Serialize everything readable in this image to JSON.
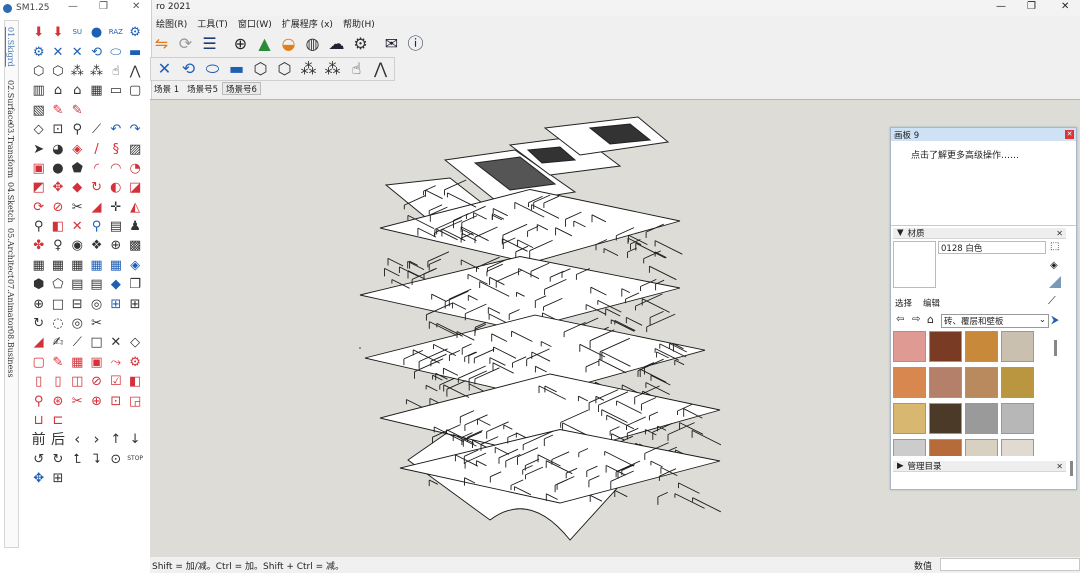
{
  "plugin": {
    "title": "SM1.25",
    "tabs": [
      "01.Skigrd",
      "02.Surface",
      "03.Transform",
      "04.Sketch",
      "05.Architect",
      "07.Animator",
      "08.Business"
    ],
    "nav_text": [
      "前",
      "后"
    ]
  },
  "app": {
    "title": "ro 2021",
    "minimize": "—",
    "maximize": "❐",
    "close": "✕"
  },
  "menu": [
    "绘图(R)",
    "工具(T)",
    "窗口(W)",
    "扩展程序 (x)",
    "帮助(H)"
  ],
  "scenes": [
    "场景 1",
    "场景号5",
    "场景号6"
  ],
  "selected_scene": 2,
  "status": {
    "hint": "Shift = 加/减。Ctrl = 加。Shift + Ctrl = 减。",
    "value_label": "数值"
  },
  "tray": {
    "title": "画板 9",
    "tip": "点击了解更多高级操作……",
    "materials": {
      "header": "材质",
      "name": "0128 白色",
      "tab_select": "选择",
      "tab_edit": "编辑",
      "category": "砖、覆层和壁板",
      "swatch_colors": [
        "#e09a94",
        "#7a3b24",
        "#c88a3a",
        "#c9c0b0",
        "#d8874e",
        "#b5806a",
        "#b98a5e",
        "#b9963f",
        "#d8b870",
        "#4b3a28",
        "#9a9a9a",
        "#b7b7b7",
        "#cccccc",
        "#b76a3a",
        "#d8d0c0",
        "#e0dad0"
      ]
    },
    "manager": "管理目录"
  },
  "colors": {
    "accent_red": "#d3323a",
    "tray_title": "#cfe1f5",
    "viewport": "#dedcd6"
  }
}
